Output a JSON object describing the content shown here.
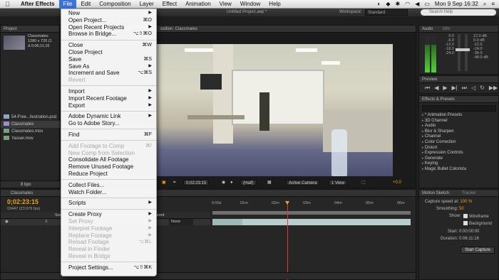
{
  "menubar": {
    "app": "After Effects",
    "items": [
      "File",
      "Edit",
      "Composition",
      "Layer",
      "Effect",
      "Animation",
      "View",
      "Window",
      "Help"
    ],
    "clock": "Mon 9 Sep  16:32"
  },
  "titlebar": {
    "title": "Untitled Project.aep *",
    "workspace_label": "Workspace:",
    "workspace_value": "Standard",
    "search_placeholder": "Search Help"
  },
  "project": {
    "tab": "Project",
    "info_name": "Classmates",
    "info_dims": "1280 x 720 (1",
    "info_dur": "Δ 0;06;11;16",
    "items": [
      "54-Free...llustration.psd",
      "Classmates",
      "Classmates.mov",
      "Yasser.mov"
    ],
    "bpc": "8 bpc"
  },
  "comp": {
    "tab": "osition: Classmates",
    "timecode": "0;02:23:15",
    "resolution": "(Half)",
    "camera": "Active Camera",
    "view": "1 View",
    "exposure": "+0.0"
  },
  "audio": {
    "tab_audio": "Audio",
    "tab_info": "Info",
    "db_left": [
      "0.0",
      "-6.0",
      "-12.0",
      "-18.0",
      "-24.0"
    ],
    "db_right": [
      "12.0 dB",
      "0.0 dB",
      "-12.0",
      "-24.0",
      "-36.0",
      "-48.0 dB"
    ]
  },
  "preview": {
    "tab": "Preview"
  },
  "effects": {
    "tab": "Effects & Presets",
    "items": [
      "* Animation Presets",
      "3D Channel",
      "Audio",
      "Blur & Sharpen",
      "Channel",
      "Color Correction",
      "Distort",
      "Expression Controls",
      "Generate",
      "Keying",
      "Magic Bullet Colorista"
    ]
  },
  "timeline": {
    "tab": "Classmates",
    "timecode": "0;02:23:15",
    "fps": "03447 (23.976 fps)",
    "col_source": "Sou",
    "col_parent": "Parent",
    "layer_parent": "None",
    "layer_num": "1",
    "ruler": [
      "0:00s",
      "01m",
      "02m",
      "03m",
      "04m",
      "05m",
      "06m"
    ]
  },
  "motion": {
    "tab": "Motion Sketch",
    "tab2": "Tracker",
    "capture_speed_label": "Capture speed at:",
    "capture_speed": "100 %",
    "smoothing_label": "Smoothing:",
    "smoothing": "50",
    "show_label": "Show:",
    "wireframe": "Wireframe",
    "background": "Background",
    "start_label": "Start:",
    "start": "0:00:00:00",
    "duration_label": "Duration:",
    "duration": "0:06:11:16",
    "start_capture": "Start Capture"
  },
  "file_menu": {
    "items": [
      {
        "label": "New",
        "shortcut": "",
        "arrow": "▶",
        "disabled": false
      },
      {
        "label": "Open Project...",
        "shortcut": "⌘O",
        "arrow": "",
        "disabled": false
      },
      {
        "label": "Open Recent Projects",
        "shortcut": "",
        "arrow": "▶",
        "disabled": false
      },
      {
        "label": "Browse in Bridge...",
        "shortcut": "⌥⇧⌘O",
        "arrow": "",
        "disabled": false
      },
      {
        "sep": true
      },
      {
        "label": "Close",
        "shortcut": "⌘W",
        "arrow": "",
        "disabled": false
      },
      {
        "label": "Close Project",
        "shortcut": "",
        "arrow": "",
        "disabled": false
      },
      {
        "label": "Save",
        "shortcut": "⌘S",
        "arrow": "",
        "disabled": false
      },
      {
        "label": "Save As",
        "shortcut": "",
        "arrow": "▶",
        "disabled": false
      },
      {
        "label": "Increment and Save",
        "shortcut": "⌥⌘S",
        "arrow": "",
        "disabled": false
      },
      {
        "label": "Revert",
        "shortcut": "",
        "arrow": "",
        "disabled": true
      },
      {
        "sep": true
      },
      {
        "label": "Import",
        "shortcut": "",
        "arrow": "▶",
        "disabled": false
      },
      {
        "label": "Import Recent Footage",
        "shortcut": "",
        "arrow": "▶",
        "disabled": false
      },
      {
        "label": "Export",
        "shortcut": "",
        "arrow": "▶",
        "disabled": false
      },
      {
        "sep": true
      },
      {
        "label": "Adobe Dynamic Link",
        "shortcut": "",
        "arrow": "▶",
        "disabled": false
      },
      {
        "label": "Go to Adobe Story...",
        "shortcut": "",
        "arrow": "",
        "disabled": false
      },
      {
        "sep": true
      },
      {
        "label": "Find",
        "shortcut": "⌘F",
        "arrow": "",
        "disabled": false
      },
      {
        "sep": true
      },
      {
        "label": "Add Footage to Comp",
        "shortcut": "⌘/",
        "arrow": "",
        "disabled": true
      },
      {
        "label": "New Comp from Selection",
        "shortcut": "",
        "arrow": "",
        "disabled": true
      },
      {
        "label": "Consolidate All Footage",
        "shortcut": "",
        "arrow": "",
        "disabled": false
      },
      {
        "label": "Remove Unused Footage",
        "shortcut": "",
        "arrow": "",
        "disabled": false
      },
      {
        "label": "Reduce Project",
        "shortcut": "",
        "arrow": "",
        "disabled": false
      },
      {
        "sep": true
      },
      {
        "label": "Collect Files...",
        "shortcut": "",
        "arrow": "",
        "disabled": false
      },
      {
        "label": "Watch Folder...",
        "shortcut": "",
        "arrow": "",
        "disabled": false
      },
      {
        "sep": true
      },
      {
        "label": "Scripts",
        "shortcut": "",
        "arrow": "▶",
        "disabled": false
      },
      {
        "sep": true
      },
      {
        "label": "Create Proxy",
        "shortcut": "",
        "arrow": "▶",
        "disabled": false
      },
      {
        "label": "Set Proxy",
        "shortcut": "",
        "arrow": "▶",
        "disabled": true
      },
      {
        "label": "Interpret Footage",
        "shortcut": "",
        "arrow": "▶",
        "disabled": true
      },
      {
        "label": "Replace Footage",
        "shortcut": "",
        "arrow": "▶",
        "disabled": true
      },
      {
        "label": "Reload Footage",
        "shortcut": "⌥⌘L",
        "arrow": "",
        "disabled": true
      },
      {
        "label": "Reveal in Finder",
        "shortcut": "",
        "arrow": "",
        "disabled": true
      },
      {
        "label": "Reveal in Bridge",
        "shortcut": "",
        "arrow": "",
        "disabled": true
      },
      {
        "sep": true
      },
      {
        "label": "Project Settings...",
        "shortcut": "⌥⇧⌘K",
        "arrow": "",
        "disabled": false
      }
    ]
  }
}
